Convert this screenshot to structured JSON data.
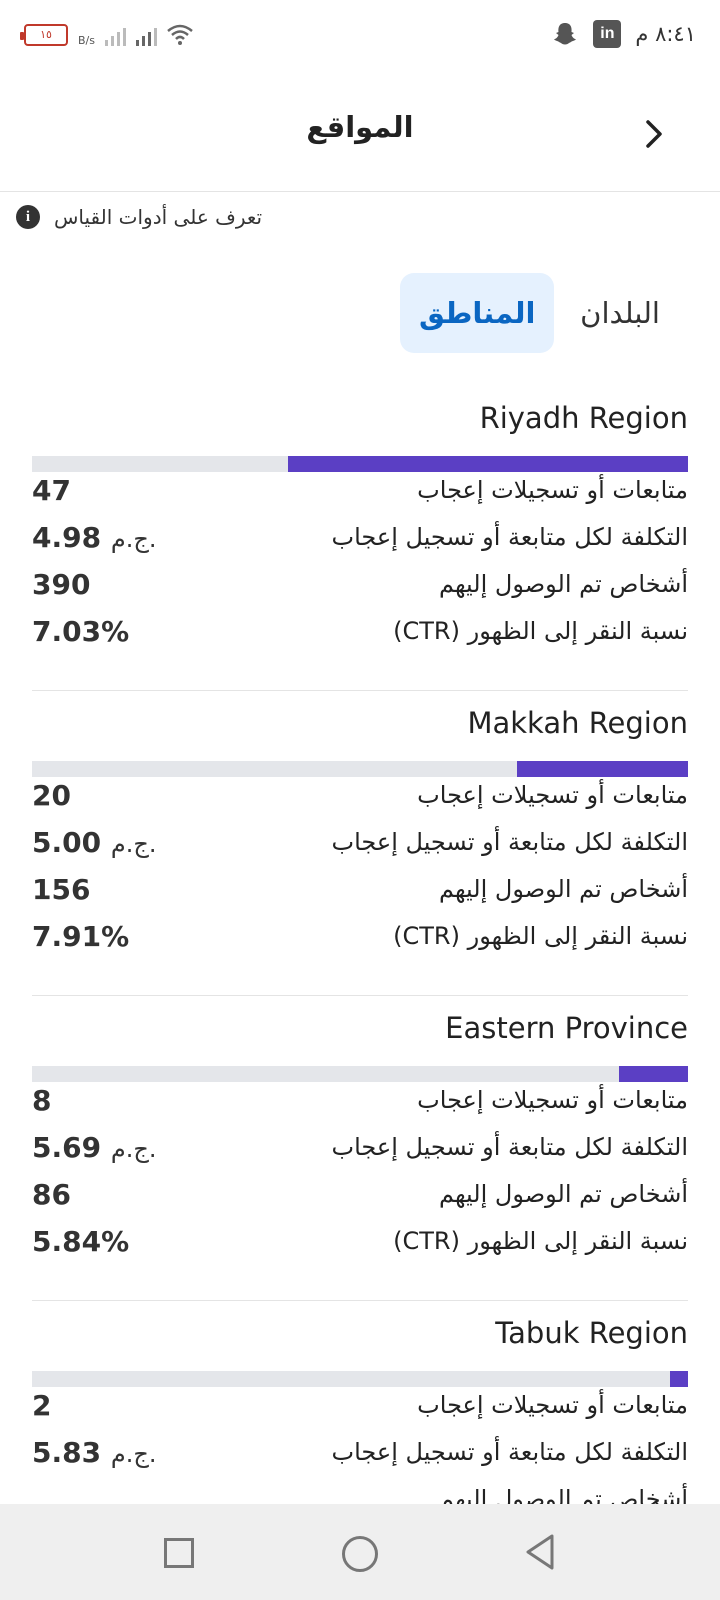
{
  "status_bar": {
    "battery": "١٥",
    "net_speed": "B/s",
    "time": "٨:٤١ م"
  },
  "header": {
    "title": "المواقع"
  },
  "info": {
    "text": "تعرف على أدوات القياس"
  },
  "tabs": [
    {
      "label": "البلدان",
      "active": false
    },
    {
      "label": "المناطق",
      "active": true
    }
  ],
  "metric_labels": {
    "followers": "متابعات أو تسجيلات إعجاب",
    "cost": "التكلفة لكل متابعة أو تسجيل إعجاب",
    "reach": "أشخاص تم الوصول إليهم",
    "ctr": "نسبة النقر إلى الظهور (CTR)"
  },
  "currency_unit": "ج.م.",
  "regions": [
    {
      "name": "Riyadh Region",
      "bar_fraction": 0.61,
      "followers": "47",
      "cost": "4.98",
      "reach": "390",
      "ctr": "7.03%"
    },
    {
      "name": "Makkah Region",
      "bar_fraction": 0.26,
      "followers": "20",
      "cost": "5.00",
      "reach": "156",
      "ctr": "7.91%"
    },
    {
      "name": "Eastern Province",
      "bar_fraction": 0.105,
      "followers": "8",
      "cost": "5.69",
      "reach": "86",
      "ctr": "5.84%"
    },
    {
      "name": "Tabuk Region",
      "bar_fraction": 0.027,
      "followers": "2",
      "cost": "5.83",
      "reach": "",
      "ctr": ""
    }
  ],
  "icons": {
    "snapchat": "snapchat-icon",
    "linkedin": "linkedin-icon",
    "wifi": "wifi-icon",
    "info": "info-icon",
    "back": "chevron-right-icon"
  },
  "colors": {
    "accent": "#0a66c2",
    "bar": "#5b3fc4",
    "track": "#e4e6ea",
    "active_tab_bg": "#e5f1fe"
  }
}
